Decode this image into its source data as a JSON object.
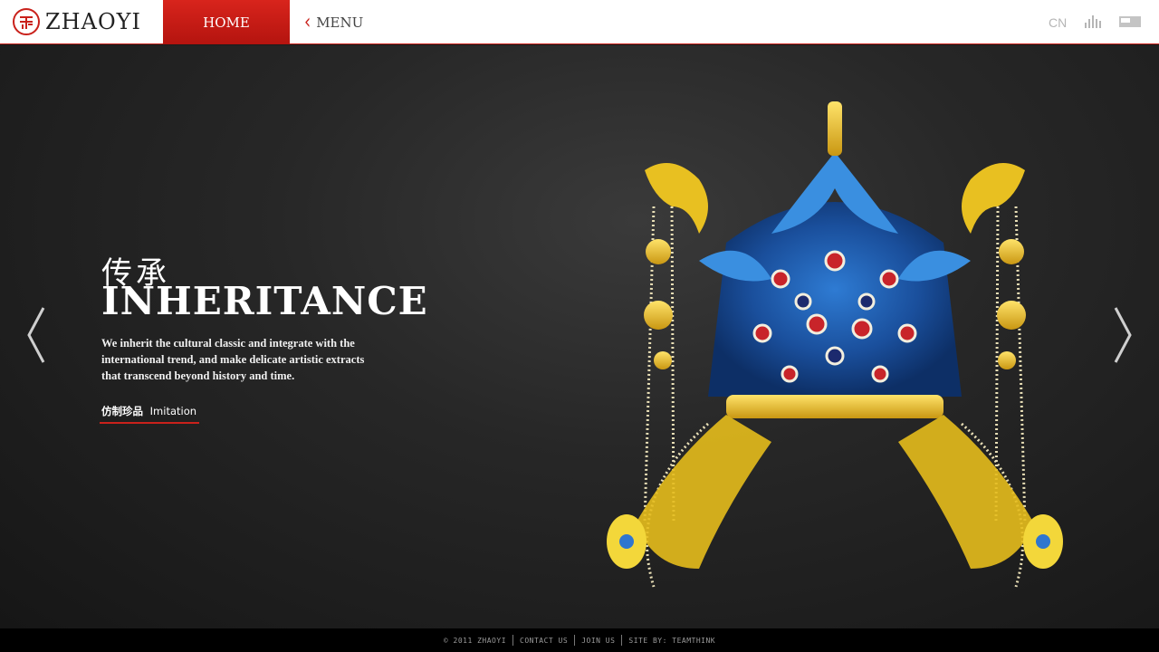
{
  "header": {
    "logo_text": "ZHAOYI",
    "nav_home": "HOME",
    "nav_menu": "MENU",
    "language": "CN",
    "icons": [
      "seal-logo-icon",
      "chevron-left-icon",
      "bars-icon",
      "window-icon"
    ]
  },
  "hero": {
    "title_cn": "传承",
    "title_en": "INHERITANCE",
    "description": "We inherit the cultural classic and integrate with the international trend, and make delicate artistic extracts that transcend beyond history and time.",
    "tag_cn": "仿制珍品",
    "tag_en": "Imitation"
  },
  "footer": {
    "copyright": "© 2011 ZHAOYI",
    "contact": "CONTACT US",
    "join": "JOIN US",
    "site_by": "SITE BY: TEAMTHINK"
  },
  "colors": {
    "accent": "#c9211b",
    "background": "#1b1b1b",
    "header": "#ffffff"
  }
}
